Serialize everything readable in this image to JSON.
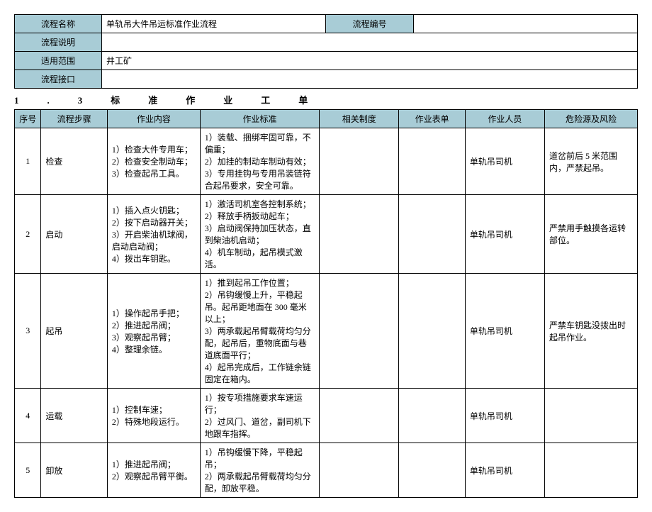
{
  "header": {
    "labels": {
      "name": "流程名称",
      "desc": "流程说明",
      "scope": "适用范围",
      "interface": "流程接口",
      "code": "流程编号"
    },
    "values": {
      "name": "单轨吊大件吊运标准作业流程",
      "desc": "",
      "scope": "井工矿",
      "interface": "",
      "code": ""
    }
  },
  "section_title": "1.3标准作业工单",
  "columns": {
    "seq": "序号",
    "step": "流程步骤",
    "content": "作业内容",
    "standard": "作业标准",
    "system": "相关制度",
    "sheet": "作业表单",
    "person": "作业人员",
    "risk": "危险源及风险"
  },
  "rows": [
    {
      "seq": "1",
      "step": "检查",
      "content": "1）检查大件专用车；2）检查安全制动车；3）检查起吊工具。",
      "standard": "1）装载、捆绑牢固可靠，不偏重；\n2）加挂的制动车制动有效；3）专用挂钩与专用吊装链符合起吊要求，安全可靠。",
      "system": "",
      "sheet": "",
      "person": "单轨吊司机",
      "risk": "道岔前后 5 米范围内，严禁起吊。"
    },
    {
      "seq": "2",
      "step": "启动",
      "content": "1）插入点火钥匙；\n2）按下启动器开关；\n3）开启柴油机球阀，启动启动阀；\n4）拨出车钥匙。",
      "standard": "1）激活司机室各控制系统；\n2）释放手柄扳动起车；\n3）启动阀保持加压状态，直到柴油机启动；\n4）机车制动，起吊模式激活。",
      "system": "",
      "sheet": "",
      "person": "单轨吊司机",
      "risk": "严禁用手触摸各运转部位。"
    },
    {
      "seq": "3",
      "step": "起吊",
      "content": "1）操作起吊手把；\n2）推进起吊阀；\n3）观察起吊臂；\n4）整理余链。",
      "standard": "1）推到起吊工作位置；\n2）吊钩缓慢上升，平稳起吊。起吊距地面在 300 毫米以上；\n3）两承载起吊臂载荷均匀分配，起吊后，重物底面与巷道底面平行；\n4）起吊完成后，工作链余链固定在箱内。",
      "system": "",
      "sheet": "",
      "person": "单轨吊司机",
      "risk": "严禁车钥匙没拨出时起吊作业。"
    },
    {
      "seq": "4",
      "step": "运载",
      "content": "1）控制车速；\n2）特殊地段运行。",
      "standard": "1）按专项措施要求车速运行；\n2）过风门、道岔，副司机下地跟车指挥。",
      "system": "",
      "sheet": "",
      "person": "单轨吊司机",
      "risk": ""
    },
    {
      "seq": "5",
      "step": "卸放",
      "content": "1）推进起吊阀；\n2）观察起吊臂平衡。",
      "standard": "1）吊钩缓慢下降，平稳起吊；\n2）两承载起吊臂载荷均匀分配，卸放平稳。",
      "system": "",
      "sheet": "",
      "person": "单轨吊司机",
      "risk": ""
    }
  ]
}
